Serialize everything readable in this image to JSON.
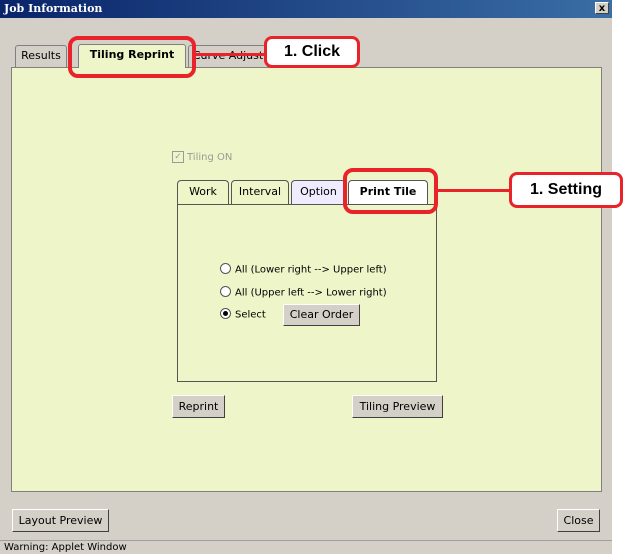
{
  "window": {
    "title": "Job Information",
    "close_label": "x"
  },
  "tabs": [
    {
      "label": "Results"
    },
    {
      "label": "Tiling Reprint"
    },
    {
      "label": "Curve Adjust"
    }
  ],
  "tiling_checkbox": {
    "label": "Tiling ON",
    "checked": true,
    "mark": "✓"
  },
  "inner_tabs": [
    {
      "label": "Work"
    },
    {
      "label": "Interval"
    },
    {
      "label": "Option"
    },
    {
      "label": "Print Tile"
    }
  ],
  "print_tile": {
    "options": [
      {
        "label": "All (Lower right --> Upper left)",
        "selected": false
      },
      {
        "label": "All (Upper left --> Lower right)",
        "selected": false
      },
      {
        "label": "Select",
        "selected": true
      }
    ],
    "clear_order_label": "Clear Order"
  },
  "buttons": {
    "reprint": "Reprint",
    "tiling_preview": "Tiling Preview",
    "layout_preview": "Layout Preview",
    "close": "Close"
  },
  "status_bar": "Warning: Applet Window",
  "annotations": {
    "click_label": "1. Click",
    "setting_label": "1. Setting",
    "color": "#e8232a"
  },
  "colors": {
    "panel_bg": "#eef5c8",
    "window_bg": "#d4d0c8",
    "titlebar": "#0a246a"
  }
}
